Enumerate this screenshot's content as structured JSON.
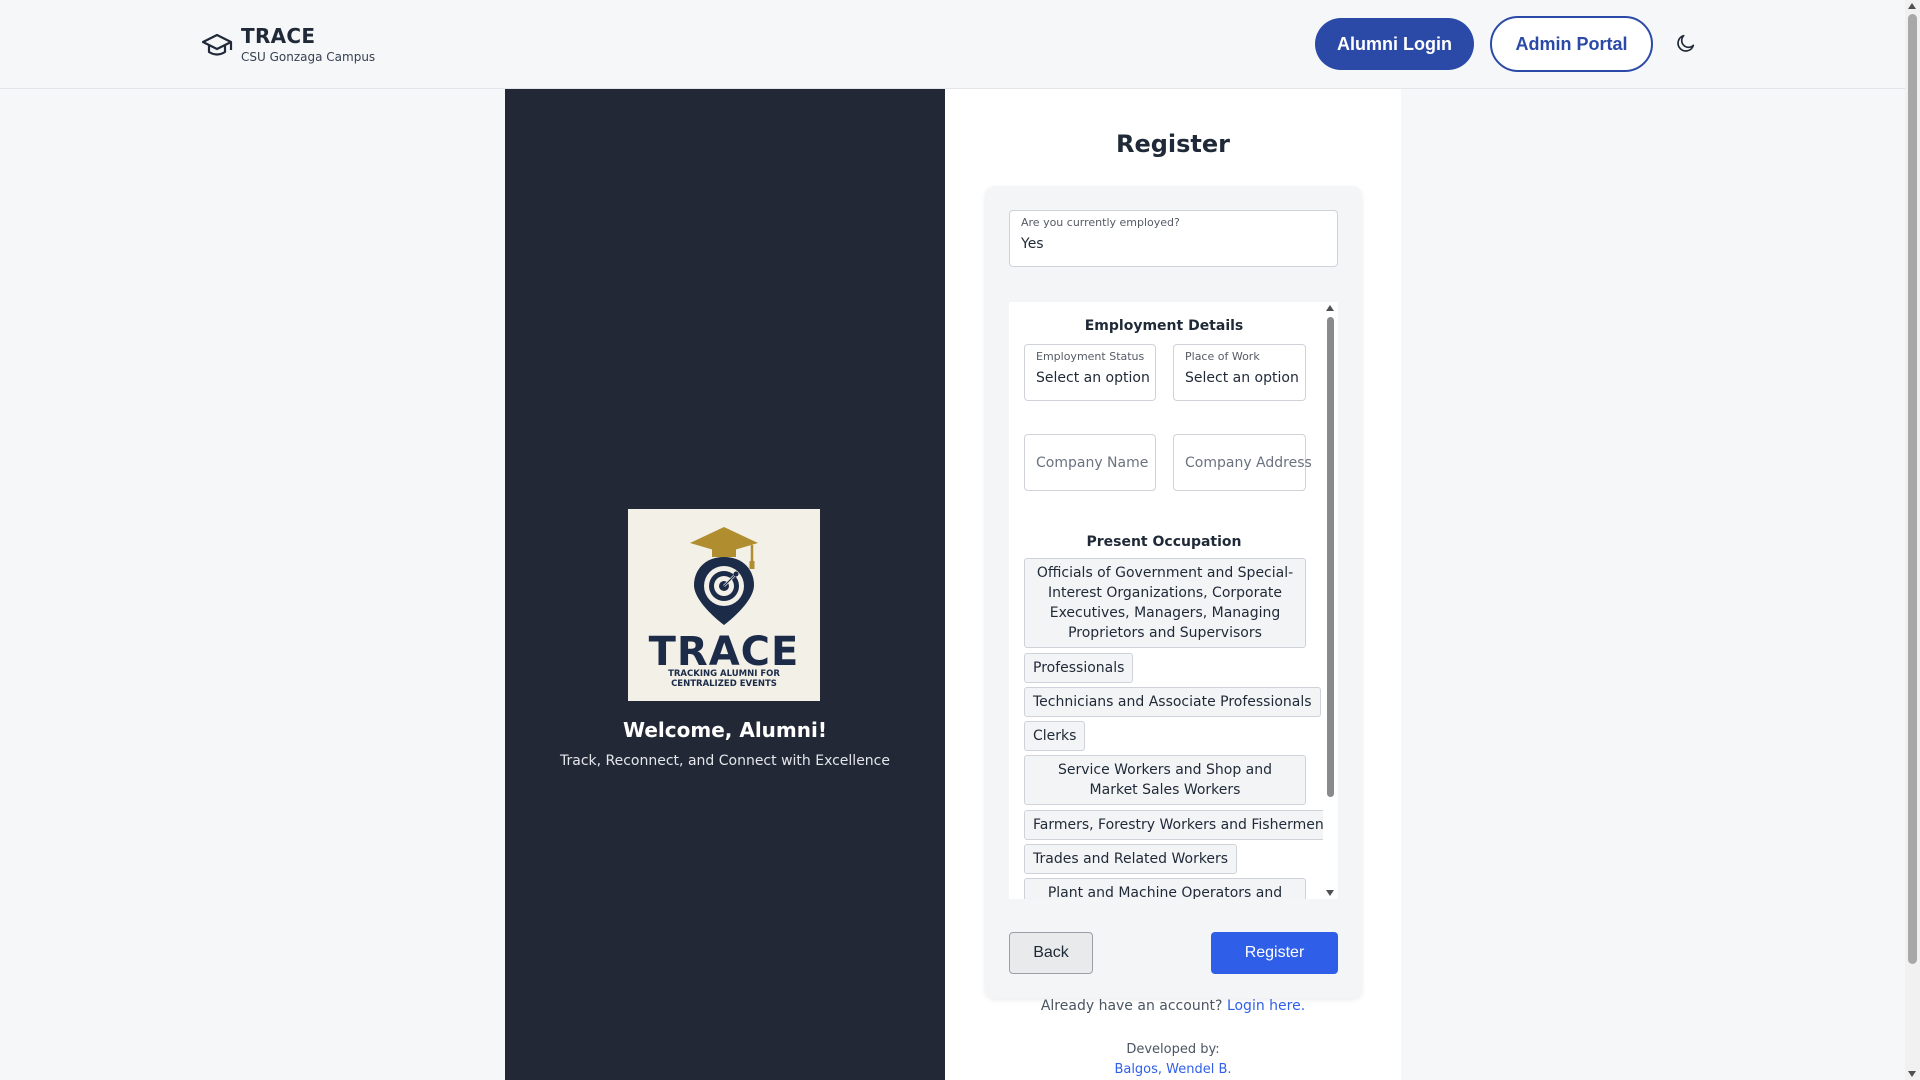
{
  "header": {
    "app_name": "TRACE",
    "campus": "CSU Gonzaga Campus",
    "alumni_login": "Alumni Login",
    "admin_portal": "Admin Portal",
    "theme_icon": "moon-icon",
    "brand_icon": "graduation-cap-icon"
  },
  "left": {
    "logo_word": "TRACE",
    "logo_tag_line1": "TRACKING ALUMNI FOR",
    "logo_tag_line2": "CENTRALIZED EVENTS",
    "welcome": "Welcome, Alumni!",
    "tagline": "Track, Reconnect, and Connect with Excellence"
  },
  "form": {
    "title": "Register",
    "employed": {
      "label": "Are you currently employed?",
      "value": "Yes"
    },
    "employment_details_title": "Employment Details",
    "employment_status": {
      "label": "Employment Status",
      "value": "Select an option"
    },
    "place_of_work": {
      "label": "Place of Work",
      "value": "Select an option"
    },
    "company_name": {
      "placeholder": "Company Name"
    },
    "company_address": {
      "placeholder": "Company Address"
    },
    "present_occupation_title": "Present Occupation",
    "occupations": [
      "Officials of Government and Special-Interest Organizations, Corporate Executives, Managers, Managing Proprietors and Supervisors",
      "Professionals",
      "Technicians and Associate Professionals",
      "Clerks",
      "Service Workers and Shop and Market Sales Workers",
      "Farmers, Forestry Workers and Fishermen",
      "Trades and Related Workers",
      "Plant and Machine Operators and"
    ],
    "back": "Back",
    "register": "Register"
  },
  "footer": {
    "already_text": "Already have an account?",
    "login_link": "Login here.",
    "developed_by": "Developed by:",
    "developer": "Balgos, Wendel B."
  },
  "colors": {
    "primary": "#2b4aa8",
    "register_button": "#2f5fe8",
    "dark_panel": "#222836",
    "logo_navy": "#1b2b48",
    "logo_gold": "#b08d2e"
  }
}
